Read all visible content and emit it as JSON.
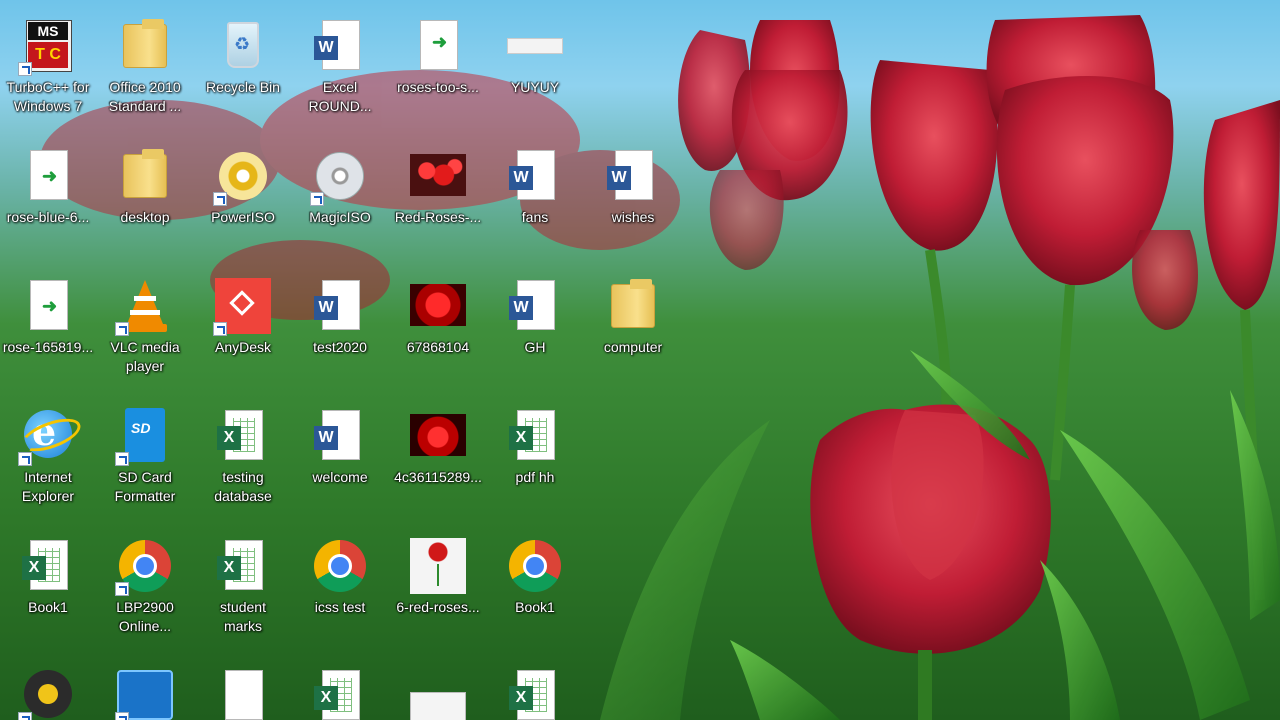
{
  "desktop": {
    "icons": [
      {
        "label": "TurboC++ for\nWindows 7",
        "icon": "turbo-c-icon"
      },
      {
        "label": "Office 2010\nStandard ...",
        "icon": "folder-icon"
      },
      {
        "label": "Recycle Bin",
        "icon": "recycle-bin-icon"
      },
      {
        "label": "Excel\nROUND...",
        "icon": "word-document-icon"
      },
      {
        "label": "roses-too-s...",
        "icon": "file-icon"
      },
      {
        "label": "YUYUY",
        "icon": "image-icon"
      },
      {
        "label": "rose-blue-6...",
        "icon": "file-icon"
      },
      {
        "label": "desktop",
        "icon": "folder-icon"
      },
      {
        "label": "PowerISO",
        "icon": "poweriso-icon"
      },
      {
        "label": "MagicISO",
        "icon": "magiciso-icon"
      },
      {
        "label": "Red-Roses-...",
        "icon": "image-icon"
      },
      {
        "label": "fans",
        "icon": "word-document-icon"
      },
      {
        "label": "wishes",
        "icon": "word-document-icon"
      },
      {
        "label": "rose-165819...",
        "icon": "file-icon"
      },
      {
        "label": "VLC media\nplayer",
        "icon": "vlc-icon"
      },
      {
        "label": "AnyDesk",
        "icon": "anydesk-icon"
      },
      {
        "label": "test2020",
        "icon": "word-document-icon"
      },
      {
        "label": "67868104",
        "icon": "image-icon"
      },
      {
        "label": "GH",
        "icon": "word-document-icon"
      },
      {
        "label": "computer",
        "icon": "folder-icon"
      },
      {
        "label": "Internet\nExplorer",
        "icon": "internet-explorer-icon"
      },
      {
        "label": "SD Card\nFormatter",
        "icon": "sd-card-icon"
      },
      {
        "label": "testing\ndatabase",
        "icon": "excel-document-icon"
      },
      {
        "label": "welcome",
        "icon": "word-document-icon"
      },
      {
        "label": "4c36115289...",
        "icon": "image-icon"
      },
      {
        "label": "pdf hh",
        "icon": "excel-document-icon"
      },
      {
        "label": "Book1",
        "icon": "excel-document-icon"
      },
      {
        "label": "LBP2900\nOnline...",
        "icon": "chrome-icon"
      },
      {
        "label": "student\nmarks",
        "icon": "excel-document-icon"
      },
      {
        "label": "icss test",
        "icon": "chrome-icon"
      },
      {
        "label": "6-red-roses...",
        "icon": "image-icon"
      },
      {
        "label": "Book1",
        "icon": "chrome-icon"
      },
      {
        "label": "",
        "icon": "music-disc-icon"
      },
      {
        "label": "",
        "icon": "intel-graphics-icon"
      },
      {
        "label": "",
        "icon": "text-document-icon"
      },
      {
        "label": "",
        "icon": "excel-document-icon"
      },
      {
        "label": "",
        "icon": "image-icon"
      },
      {
        "label": "",
        "icon": "excel-document-icon"
      }
    ]
  },
  "colors": {
    "word": "#2b5797",
    "excel": "#1e7145",
    "chrome_red": "#db4437",
    "chrome_yellow": "#f4b400",
    "chrome_green": "#0f9d58",
    "chrome_blue": "#4285f4",
    "anydesk": "#ef443b",
    "vlc": "#f08a00"
  }
}
